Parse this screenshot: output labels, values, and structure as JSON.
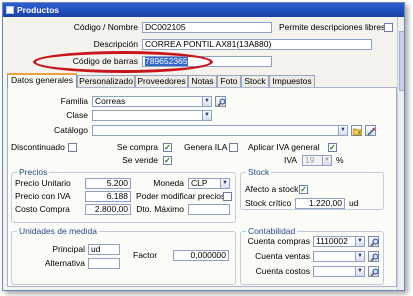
{
  "window": {
    "title": "Productos"
  },
  "header": {
    "code_label": "Código / Nombre",
    "code_value": "DC002105",
    "free_desc_label": "Permite descripciones libres",
    "description_label": "Descripción",
    "description_value": "CORREA PONTIL AX81(13A880)",
    "barcode_label": "Código de barras",
    "barcode_value": "789652365"
  },
  "tabs": [
    {
      "label": "Datos generales",
      "active": true
    },
    {
      "label": "Personalizado"
    },
    {
      "label": "Proveedores"
    },
    {
      "label": "Notas"
    },
    {
      "label": "Foto"
    },
    {
      "label": "Stock"
    },
    {
      "label": "Impuestos"
    }
  ],
  "general": {
    "family_label": "Familia",
    "family_value": "Correas",
    "class_label": "Clase",
    "class_value": "",
    "catalog_label": "Catálogo",
    "catalog_value": "",
    "discontinued_label": "Discontinuado",
    "bought_label": "Se compra",
    "sold_label": "Se vende",
    "ila_label": "Genera ILA",
    "iva_general_label": "Aplicar IVA general",
    "iva_label": "IVA",
    "iva_value": "19",
    "percent": "%"
  },
  "precios": {
    "title": "Precios",
    "unit_price_label": "Precio Unitario",
    "unit_price_value": "5.200",
    "price_iva_label": "Precio con IVA",
    "price_iva_value": "6.188",
    "cost_label": "Costo Compra",
    "cost_value": "2.800,00",
    "currency_label": "Moneda",
    "currency_value": "CLP",
    "modify_prices_label": "Poder modificar precios",
    "max_dto_label": "Dto. Máximo",
    "max_dto_value": ""
  },
  "stock": {
    "title": "Stock",
    "affects_label": "Afecto a stock",
    "critical_label": "Stock crítico",
    "critical_value": "1.220,00",
    "unit": "ud"
  },
  "unidades": {
    "title": "Unidades de medida",
    "principal_label": "Principal",
    "principal_value": "ud",
    "alternativa_label": "Alternativa",
    "alternativa_value": "",
    "factor_label": "Factor",
    "factor_value": "0,000000"
  },
  "contabilidad": {
    "title": "Contabilidad",
    "purchase_label": "Cuenta compras",
    "purchase_value": "1110002",
    "sales_label": "Cuenta ventas",
    "sales_value": "",
    "costs_label": "Cuenta costos",
    "costs_value": ""
  },
  "colors": {
    "titlebar": "#1a42a6",
    "highlight": "#c8141d",
    "active_tab_accent": "#e9a23c",
    "group_title": "#2c4b8c"
  },
  "icons": [
    "window-icon",
    "search-icon",
    "folder-icon",
    "edit-icon",
    "dropdown-arrow-icon",
    "checkmark-icon"
  ]
}
